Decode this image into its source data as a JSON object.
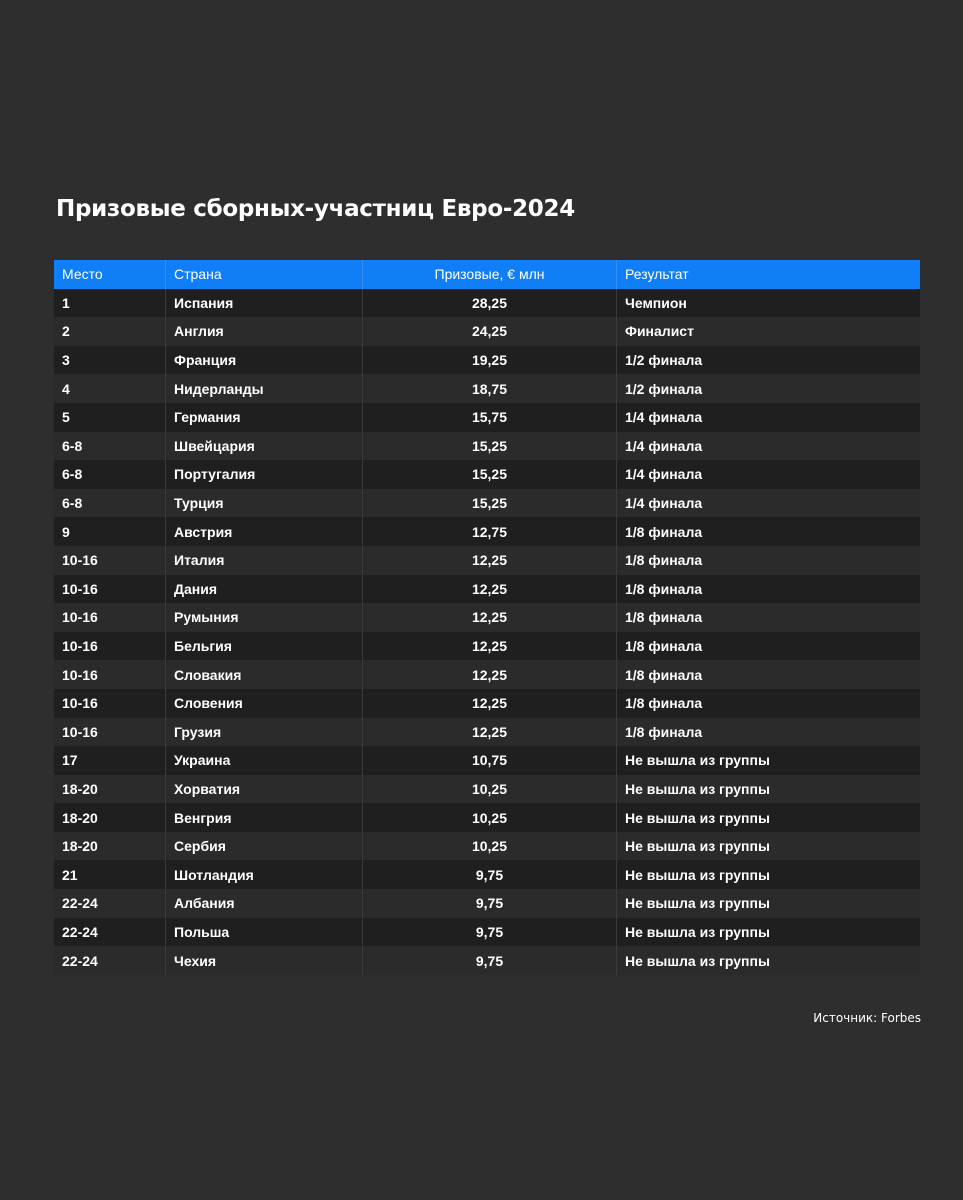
{
  "title": "Призовые сборных-участниц Евро-2024",
  "table": {
    "headers": {
      "place": "Место",
      "country": "Страна",
      "prize": "Призовые, € млн",
      "result": "Результат"
    },
    "rows": [
      {
        "place": "1",
        "country": "Испания",
        "prize": "28,25",
        "result": "Чемпион"
      },
      {
        "place": "2",
        "country": "Англия",
        "prize": "24,25",
        "result": "Финалист"
      },
      {
        "place": "3",
        "country": "Франция",
        "prize": "19,25",
        "result": "1/2 финала"
      },
      {
        "place": "4",
        "country": "Нидерланды",
        "prize": "18,75",
        "result": "1/2 финала"
      },
      {
        "place": "5",
        "country": "Германия",
        "prize": "15,75",
        "result": "1/4 финала"
      },
      {
        "place": "6-8",
        "country": "Швейцария",
        "prize": "15,25",
        "result": "1/4 финала"
      },
      {
        "place": "6-8",
        "country": "Португалия",
        "prize": "15,25",
        "result": "1/4 финала"
      },
      {
        "place": "6-8",
        "country": "Турция",
        "prize": "15,25",
        "result": "1/4 финала"
      },
      {
        "place": "9",
        "country": "Австрия",
        "prize": "12,75",
        "result": "1/8 финала"
      },
      {
        "place": "10-16",
        "country": "Италия",
        "prize": "12,25",
        "result": "1/8 финала"
      },
      {
        "place": "10-16",
        "country": "Дания",
        "prize": "12,25",
        "result": "1/8 финала"
      },
      {
        "place": "10-16",
        "country": "Румыния",
        "prize": "12,25",
        "result": "1/8 финала"
      },
      {
        "place": "10-16",
        "country": "Бельгия",
        "prize": "12,25",
        "result": "1/8 финала"
      },
      {
        "place": "10-16",
        "country": "Словакия",
        "prize": "12,25",
        "result": "1/8 финала"
      },
      {
        "place": "10-16",
        "country": "Словения",
        "prize": "12,25",
        "result": "1/8 финала"
      },
      {
        "place": "10-16",
        "country": "Грузия",
        "prize": "12,25",
        "result": "1/8 финала"
      },
      {
        "place": "17",
        "country": "Украина",
        "prize": "10,75",
        "result": "Не вышла из группы"
      },
      {
        "place": "18-20",
        "country": "Хорватия",
        "prize": "10,25",
        "result": "Не вышла из группы"
      },
      {
        "place": "18-20",
        "country": "Венгрия",
        "prize": "10,25",
        "result": "Не вышла из группы"
      },
      {
        "place": "18-20",
        "country": "Сербия",
        "prize": "10,25",
        "result": "Не вышла из группы"
      },
      {
        "place": "21",
        "country": "Шотландия",
        "prize": "9,75",
        "result": "Не вышла из группы"
      },
      {
        "place": "22-24",
        "country": "Албания",
        "prize": "9,75",
        "result": "Не вышла из группы"
      },
      {
        "place": "22-24",
        "country": "Польша",
        "prize": "9,75",
        "result": "Не вышла из группы"
      },
      {
        "place": "22-24",
        "country": "Чехия",
        "prize": "9,75",
        "result": "Не вышла из группы"
      }
    ]
  },
  "source": "Источник: Forbes",
  "colors": {
    "background": "#2e2e2e",
    "header": "#0f7ef7",
    "row_dark": "#1f1f1f",
    "row_light": "#2b2b2b",
    "text": "#ffffff"
  }
}
